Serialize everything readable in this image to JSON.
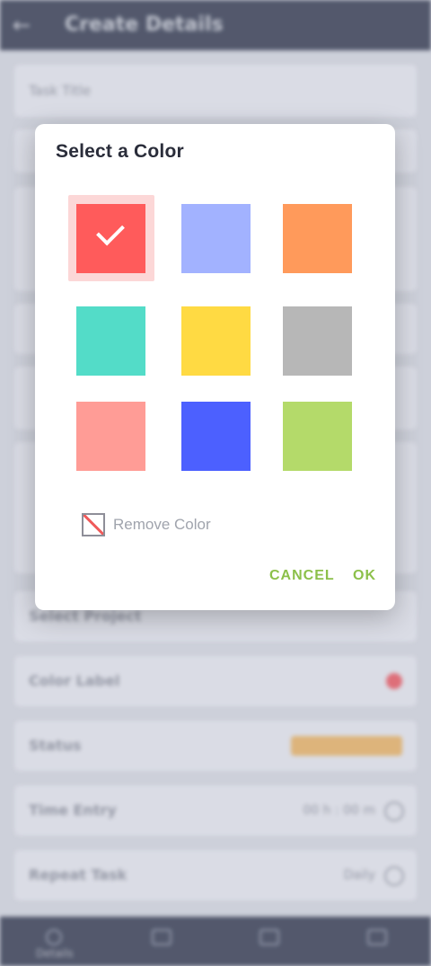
{
  "background": {
    "title": "Create Details",
    "fields": [
      {
        "label": "Task Title"
      },
      {
        "label": "Select Project"
      },
      {
        "label": "Color Label"
      },
      {
        "label": "Status"
      },
      {
        "label": "Time Entry",
        "value": "00 h : 00 m"
      },
      {
        "label": "Repeat Task",
        "value": "Daily"
      }
    ],
    "bottom_nav": [
      {
        "icon": "home-icon",
        "label": "Details"
      },
      {
        "icon": "chat-icon",
        "label": ""
      },
      {
        "icon": "calendar-icon",
        "label": ""
      },
      {
        "icon": "folder-icon",
        "label": ""
      }
    ]
  },
  "dialog": {
    "title": "Select a Color",
    "swatches": [
      {
        "name": "red",
        "color": "#FF5B5B",
        "selected": true
      },
      {
        "name": "periwinkle",
        "color": "#A2B2FF",
        "selected": false
      },
      {
        "name": "orange",
        "color": "#FF9A5B",
        "selected": false
      },
      {
        "name": "turquoise",
        "color": "#53DCC8",
        "selected": false
      },
      {
        "name": "yellow",
        "color": "#FFDA43",
        "selected": false
      },
      {
        "name": "gray",
        "color": "#B7B7B7",
        "selected": false
      },
      {
        "name": "pink",
        "color": "#FF9C96",
        "selected": false
      },
      {
        "name": "blue",
        "color": "#4C60FF",
        "selected": false
      },
      {
        "name": "green",
        "color": "#B4DA6A",
        "selected": false
      }
    ],
    "remove_label": "Remove Color",
    "cancel_label": "CANCEL",
    "ok_label": "OK",
    "accent_color": "#8CC04A"
  }
}
